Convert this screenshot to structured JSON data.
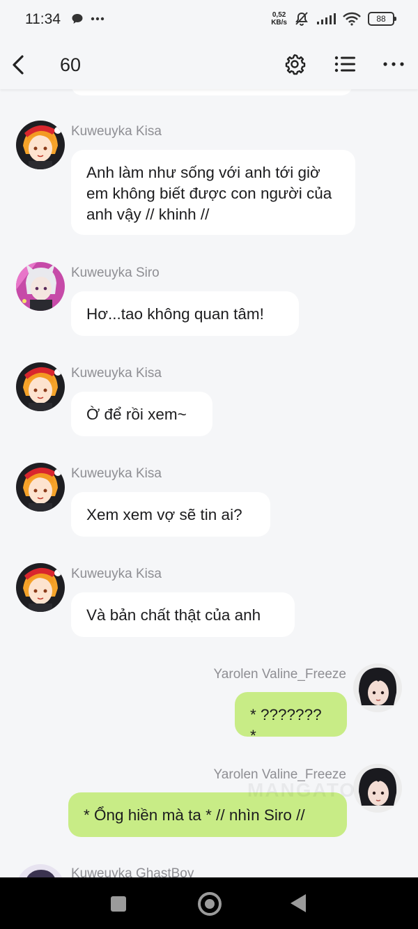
{
  "status_bar": {
    "time": "11:34",
    "net_speed_value": "0,52",
    "net_speed_unit": "KB/s",
    "battery": "88"
  },
  "top_bar": {
    "title": "60",
    "icons": [
      "back-arrow-icon",
      "gear-icon",
      "list-icon",
      "more-icon"
    ]
  },
  "messages": [
    {
      "side": "left",
      "sender": "Kuweuyka Kisa",
      "text": "Anh làm như sống với anh tới giờ em không biết được con người của anh vậy // khinh //"
    },
    {
      "side": "left",
      "sender": "Kuweuyka Siro",
      "text": "Hơ...tao không quan tâm!"
    },
    {
      "side": "left",
      "sender": "Kuweuyka Kisa",
      "text": "Ờ để rồi xem~"
    },
    {
      "side": "left",
      "sender": "Kuweuyka Kisa",
      "text": "Xem xem vợ sẽ tin ai?"
    },
    {
      "side": "left",
      "sender": "Kuweuyka Kisa",
      "text": "Và bản chất thật của anh"
    },
    {
      "side": "right",
      "sender": "Yarolen Valine_Freeze",
      "text": "* ??????? *"
    },
    {
      "side": "right",
      "sender": "Yarolen Valine_Freeze",
      "text": "* Ổng hiền mà ta * // nhìn Siro //"
    },
    {
      "side": "left",
      "sender": "Kuweuyka GhastBoy",
      "text": ""
    }
  ],
  "watermark": "MANGATO",
  "colors": {
    "background": "#f5f6f8",
    "left_bubble": "#ffffff",
    "right_bubble": "#c8ec86",
    "sender_name": "#8e8e93",
    "nav_bar": "#000000"
  }
}
